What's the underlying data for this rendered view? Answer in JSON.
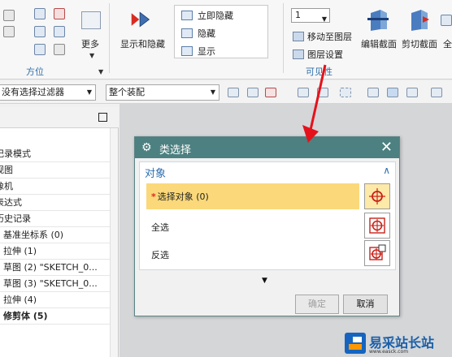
{
  "ribbon": {
    "orientation_group": {
      "label": "方位"
    },
    "more": {
      "label": "更多"
    },
    "show_hide_button": {
      "label": "显示和隐藏"
    },
    "show_hide_menu": [
      "立即隐藏",
      "隐藏",
      "显示"
    ],
    "layer": {
      "combo_value": "1",
      "move_to_layer": "移动至图层",
      "layer_settings": "图层设置",
      "group_label": "可见性"
    },
    "edit_section": {
      "label": "编辑截面"
    },
    "clip_section": {
      "label": "剪切截面"
    },
    "truncated_label": "全"
  },
  "filter_bar": {
    "filter_combo": "没有选择过滤器",
    "scope_combo": "整个装配"
  },
  "navigator": {
    "items": [
      {
        "label": "记录模式",
        "bold": false
      },
      {
        "label": "视图",
        "bold": false
      },
      {
        "label": "像机",
        "bold": false
      },
      {
        "label": "表达式",
        "bold": false
      },
      {
        "label": "历史记录",
        "bold": false
      },
      {
        "label": "基准坐标系 (0)",
        "bold": false
      },
      {
        "label": "拉伸 (1)",
        "bold": false
      },
      {
        "label": "草图 (2) \"SKETCH_0...",
        "bold": false
      },
      {
        "label": "草图 (3) \"SKETCH_0...",
        "bold": false
      },
      {
        "label": "拉伸 (4)",
        "bold": false
      },
      {
        "label": "修剪体 (5)",
        "bold": true
      }
    ]
  },
  "dialog": {
    "title": "类选择",
    "section": "对象",
    "rows": [
      {
        "label": "选择对象 (0)",
        "required": "*"
      },
      {
        "label": "全选"
      },
      {
        "label": "反选"
      }
    ],
    "ok_label": "确定",
    "cancel_label": "取消"
  },
  "watermark": {
    "text": "易采站长站",
    "sub": "www.easck.com"
  },
  "colors": {
    "dialog_title_bg": "#4d8080",
    "selection_row": "#fbd97a",
    "section_header": "#2d6fb0",
    "annotation_arrow": "#e5121b"
  }
}
